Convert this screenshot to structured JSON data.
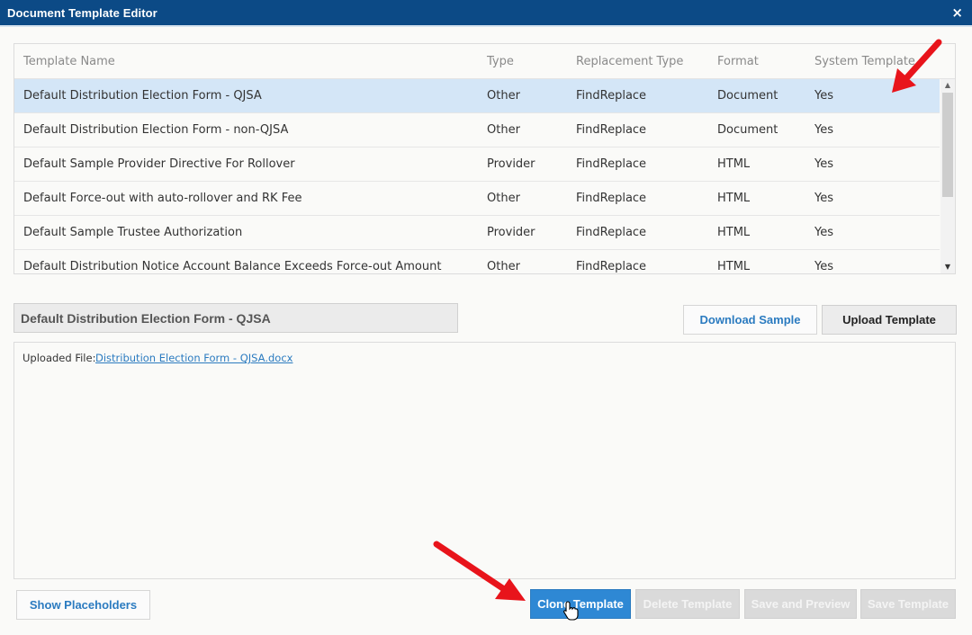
{
  "window": {
    "title": "Document Template Editor",
    "close_glyph": "×"
  },
  "grid": {
    "headers": {
      "name": "Template Name",
      "type": "Type",
      "replacement_type": "Replacement Type",
      "format": "Format",
      "system": "System Template"
    },
    "rows": [
      {
        "name": "Default Distribution Election Form - QJSA",
        "type": "Other",
        "replacement_type": "FindReplace",
        "format": "Document",
        "system": "Yes",
        "selected": true
      },
      {
        "name": "Default Distribution Election Form - non-QJSA",
        "type": "Other",
        "replacement_type": "FindReplace",
        "format": "Document",
        "system": "Yes"
      },
      {
        "name": "Default Sample Provider Directive For Rollover",
        "type": "Provider",
        "replacement_type": "FindReplace",
        "format": "HTML",
        "system": "Yes"
      },
      {
        "name": "Default Force-out with auto-rollover and RK Fee",
        "type": "Other",
        "replacement_type": "FindReplace",
        "format": "HTML",
        "system": "Yes"
      },
      {
        "name": "Default Sample Trustee Authorization",
        "type": "Provider",
        "replacement_type": "FindReplace",
        "format": "HTML",
        "system": "Yes"
      },
      {
        "name": "Default Distribution Notice Account Balance Exceeds Force-out Amount",
        "type": "Other",
        "replacement_type": "FindReplace",
        "format": "HTML",
        "system": "Yes"
      }
    ]
  },
  "editor": {
    "template_name": "Default Distribution Election Form - QJSA",
    "download_sample": "Download Sample",
    "upload_template": "Upload Template",
    "uploaded_label": "Uploaded File:",
    "uploaded_file": "Distribution Election Form - QJSA.docx"
  },
  "footer": {
    "show_placeholders": "Show Placeholders",
    "clone_template": "Clone Template",
    "delete_template": "Delete Template",
    "save_and_preview": "Save and Preview",
    "save_template": "Save Template"
  },
  "colors": {
    "titlebar": "#0c4a86",
    "selected_row": "#d4e6f7",
    "primary_button": "#2e88d4",
    "link": "#2b7bc0",
    "annotation_arrow": "#e8141b"
  },
  "icons": {
    "scroll_up": "▲",
    "scroll_down": "▼"
  }
}
